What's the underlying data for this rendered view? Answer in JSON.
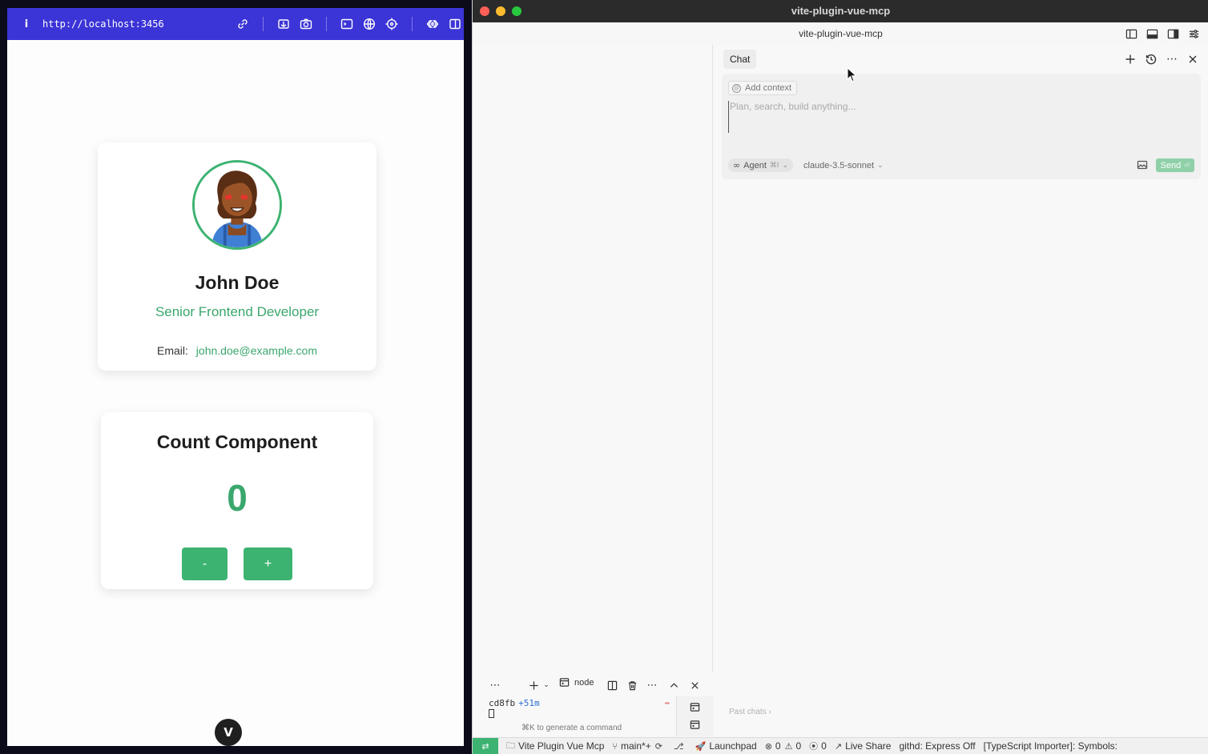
{
  "browser": {
    "url": "http://localhost:3456",
    "toolbar_icons": [
      "link-icon",
      "inspect-icon",
      "camera-icon",
      "terminal-icon",
      "globe-icon",
      "crosshair-icon",
      "vue-devtools-icon",
      "split-view-icon"
    ]
  },
  "profile": {
    "name": "John Doe",
    "title": "Senior Frontend Developer",
    "email_label": "Email:",
    "email": "john.doe@example.com"
  },
  "counter": {
    "title": "Count Component",
    "value": "0",
    "decrement_label": "-",
    "increment_label": "+"
  },
  "vue_badge": "V",
  "editor": {
    "window_title": "vite-plugin-vue-mcp",
    "workspace_title": "vite-plugin-vue-mcp",
    "chat": {
      "tab_label": "Chat",
      "add_context_label": "Add context",
      "input_placeholder": "Plan, search, build anything...",
      "mode_label": "Agent",
      "mode_shortcut": "⌘I",
      "model_label": "claude-3.5-sonnet",
      "send_label": "Send",
      "send_shortcut": "⏎",
      "past_chats_label": "Past chats ›"
    },
    "terminal": {
      "tab_label": "node",
      "prompt_hash": "cd8fb",
      "prompt_time": "+51m",
      "hint": "⌘K to generate a command"
    },
    "statusbar": {
      "project": "Vite Plugin Vue Mcp",
      "branch": "main*+",
      "launchpad": "Launchpad",
      "errors": "0",
      "warnings": "0",
      "ports": "0",
      "live_share": "Live Share",
      "githd": "githd: Express Off",
      "ts_importer": "[TypeScript Importer]: Symbols:"
    }
  },
  "colors": {
    "browser_toolbar": "#3b34d6",
    "accent_green": "#3cb371",
    "send_button": "#8fd0a8"
  }
}
